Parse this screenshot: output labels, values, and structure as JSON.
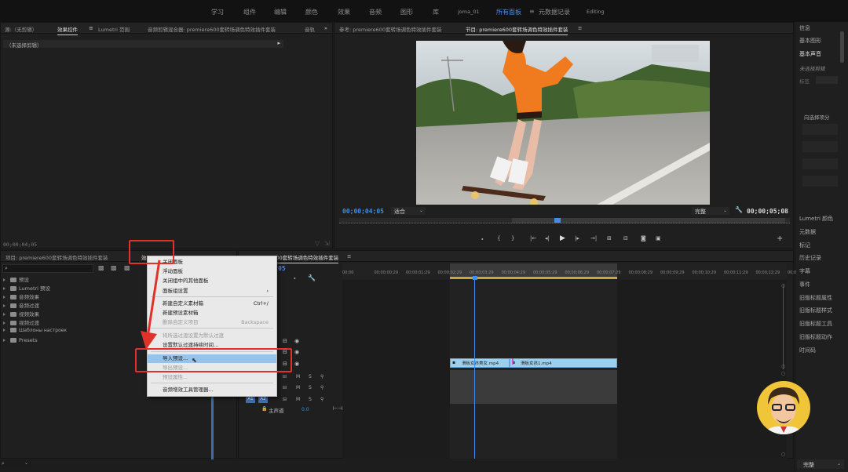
{
  "topbar": {
    "tabs": [
      "学习",
      "组件",
      "编辑",
      "颜色",
      "效果",
      "音频",
      "图形",
      "库",
      "joma_01",
      "所有面板",
      "元数据记录",
      "Editing"
    ],
    "active_tab": "所有面板"
  },
  "source_panel": {
    "tabs": [
      "源:（无剪辑）",
      "效果控件",
      "Lumetri 范围",
      "音频剪辑混合器: premiere600套转场调色特效插件套装",
      "音轨"
    ],
    "active_tab": "效果控件",
    "no_clip": "（未选择剪辑）",
    "timecode": "00;00;04;05"
  },
  "program_panel": {
    "tabs": [
      "参考: premiere600套转场调色特效插件套装",
      "节目: premiere600套转场调色特效插件套装"
    ],
    "active_tab": "节目: premiere600套转场调色特效插件套装",
    "timecode_left": "00;00;04;05",
    "fit": "适合",
    "quality": "完整",
    "timecode_right": "00;00;05;08"
  },
  "project_panel": {
    "tabs": [
      "项目: premiere600套转场调色特效插件套装",
      "效果"
    ],
    "active_tab": "效果",
    "search_icon": "search-icon",
    "items": [
      "预设",
      "Lumetri 预设",
      "音频效果",
      "音频过渡",
      "视频效果",
      "视频过渡",
      "Шаблоны настроек",
      "Presets"
    ]
  },
  "context_menu": {
    "items": [
      {
        "label": "关闭面板",
        "disabled": false
      },
      {
        "label": "浮动面板",
        "disabled": false
      },
      {
        "label": "关闭组中的其他面板",
        "disabled": false
      },
      {
        "label": "面板组设置",
        "disabled": false,
        "submenu": true
      },
      {
        "label": "新建自定义素材箱",
        "disabled": false,
        "shortcut": "Ctrl+/"
      },
      {
        "label": "新建预设素材箱",
        "disabled": false
      },
      {
        "label": "删除自定义项目",
        "disabled": true,
        "shortcut": "Backspace"
      },
      {
        "label": "将所选过渡设置为默认过渡",
        "disabled": true
      },
      {
        "label": "设置默认过渡持续时间...",
        "disabled": false
      },
      {
        "label": "导入预设...",
        "disabled": false,
        "highlighted": true
      },
      {
        "label": "导出预设...",
        "disabled": true
      },
      {
        "label": "预设属性...",
        "disabled": true
      },
      {
        "label": "音频增效工具管理器...",
        "disabled": false
      }
    ]
  },
  "timeline": {
    "tab": "premiere600套转场调色特效插件套装",
    "timecode_fragment": "05",
    "ruler": [
      "00;00",
      "00;00;00;29",
      "00;00;01;29",
      "00;00;02;29",
      "00;00;03;29",
      "00;00;04;29",
      "00;00;05;29",
      "00;00;06;29",
      "00;00;07;29",
      "00;00;08;29",
      "00;00;09;29",
      "00;00;10;29",
      "00;00;11;29",
      "00;00;12;29",
      "00;0"
    ],
    "clips": [
      "滑板女孩美女.mp4",
      "滑板女孩1.mp4"
    ],
    "master": "主声道",
    "master_value": "0.0",
    "track_labels": [
      "A1",
      "A2"
    ],
    "track_buttons": [
      "M",
      "S"
    ]
  },
  "right_panel": {
    "items": [
      "信息",
      "基本图形",
      "基本声音",
      "未选择剪辑",
      "标签",
      "向选择项分",
      "Lumetri 颜色",
      "元数据",
      "标记",
      "历史记录",
      "字幕",
      "事件",
      "旧版标题属性",
      "旧版标题样式",
      "旧版标题工具",
      "旧版标题动作",
      "时间码"
    ],
    "bottom_select": "完整"
  },
  "avatar_badge": "avatar"
}
